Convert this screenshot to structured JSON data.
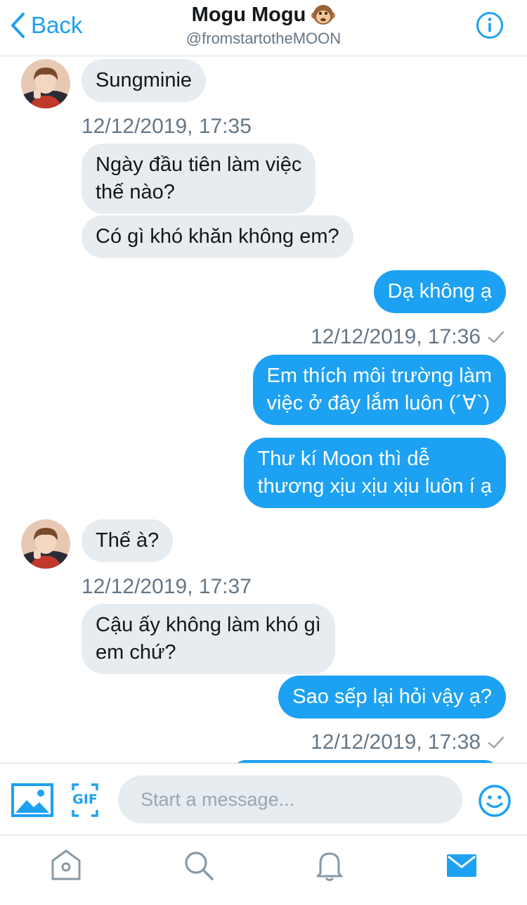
{
  "header": {
    "back_label": "Back",
    "title": "Mogu Mogu",
    "title_emoji": "monkey-face",
    "handle": "@fromstartotheMOON",
    "accent_color": "#1da1f2"
  },
  "messages": [
    {
      "side": "in",
      "text": "Sungminie"
    },
    {
      "side": "in",
      "time": "12/12/2019, 17:35"
    },
    {
      "side": "in",
      "text": "Ngày đầu tiên làm việc\nthế nào?"
    },
    {
      "side": "in",
      "text": "Có gì khó khăn không em?"
    },
    {
      "side": "out",
      "text": "Dạ không ạ"
    },
    {
      "side": "out",
      "time": "12/12/2019, 17:36",
      "status": "checkmark"
    },
    {
      "side": "out",
      "text": "Em thích môi trường làm\nviệc ở đây lắm luôn (´∀`)"
    },
    {
      "side": "out",
      "text": "Thư kí Moon thì dễ\nthương xịu xịu xịu luôn í ạ"
    },
    {
      "side": "in",
      "text": "Thế à?"
    },
    {
      "side": "in",
      "time": "12/12/2019, 17:37"
    },
    {
      "side": "in",
      "text": "Cậu ấy không làm khó gì\nem chứ?"
    },
    {
      "side": "out",
      "text": "Sao sếp lại hỏi vậy ạ?"
    },
    {
      "side": "out",
      "time": "12/12/2019, 17:38",
      "status": "checkmark"
    }
  ],
  "composer": {
    "placeholder": "Start a message...",
    "gif_label": "GIF",
    "media_icon": "image-icon",
    "emoji_icon": "smiley-icon"
  },
  "tabbar": {
    "icons": [
      "home-icon",
      "search-icon",
      "notifications-icon",
      "messages-icon"
    ],
    "active": "messages-icon"
  },
  "colors": {
    "incoming_bubble": "#e6ecf0",
    "outgoing_bubble": "#1da1f2",
    "timestamp": "#657786"
  }
}
